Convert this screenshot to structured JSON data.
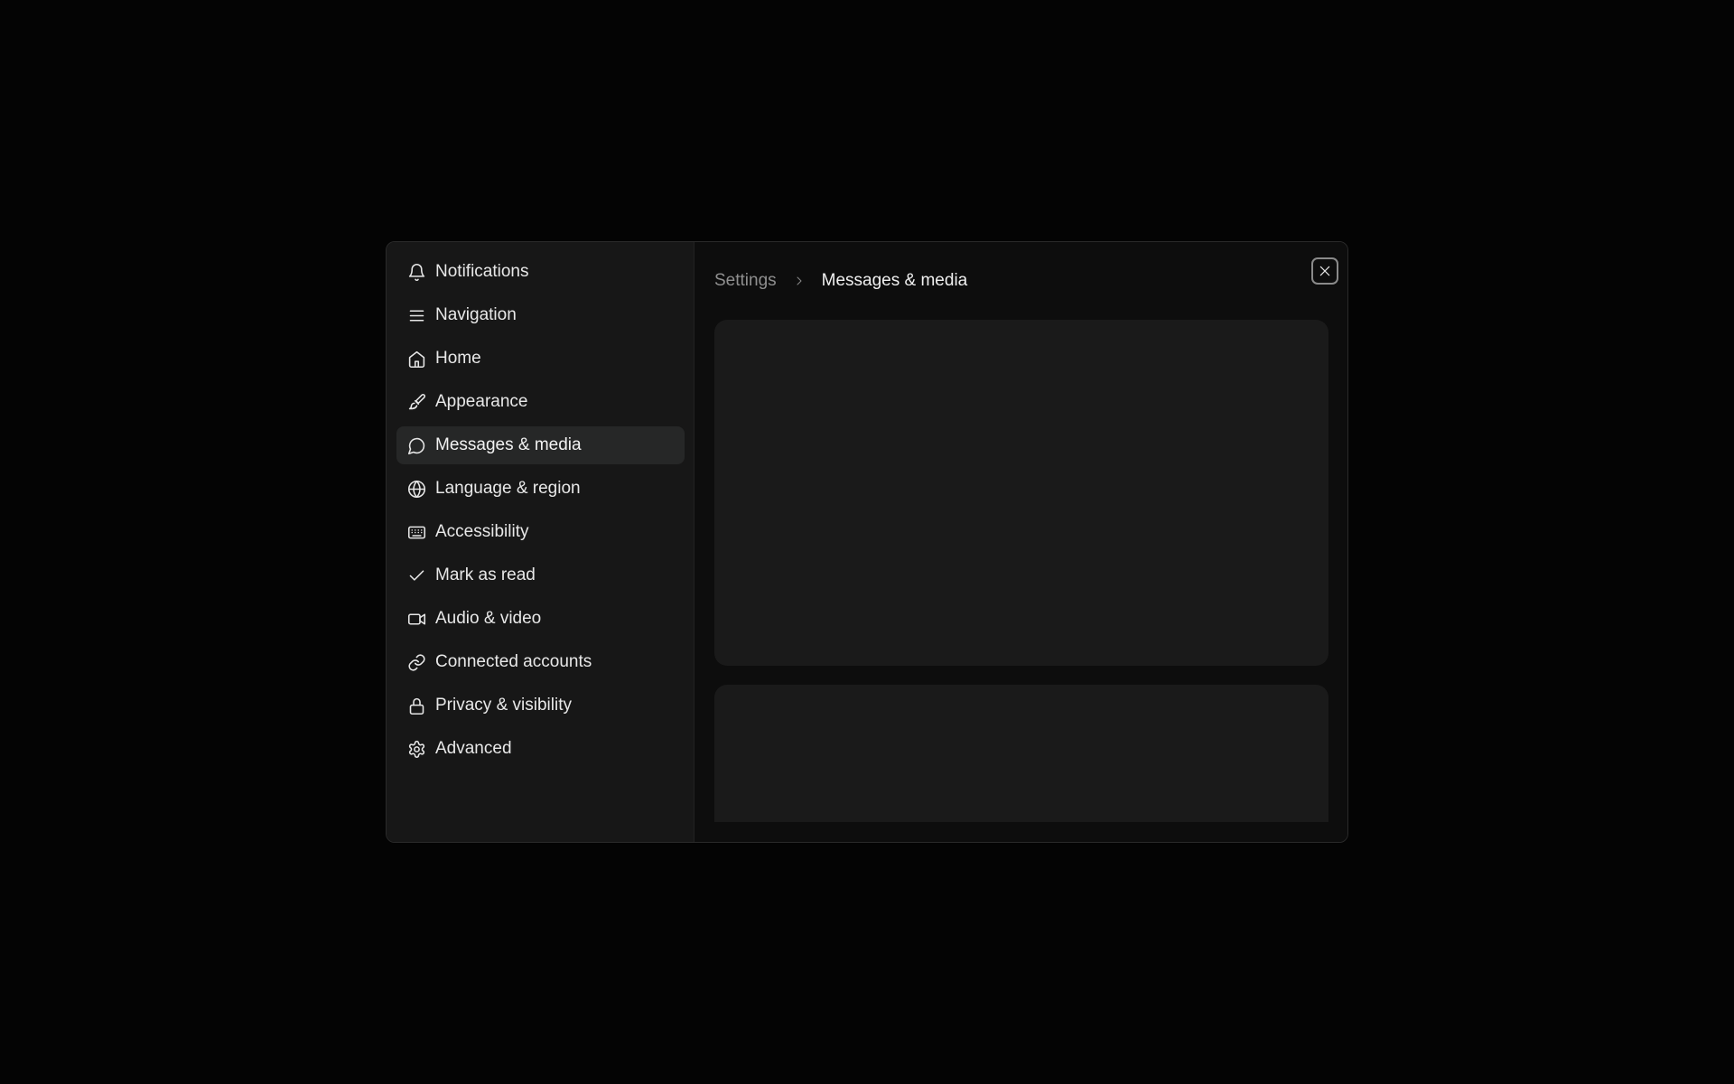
{
  "sidebar": {
    "items": [
      {
        "label": "Notifications",
        "icon": "bell-icon",
        "active": false
      },
      {
        "label": "Navigation",
        "icon": "menu-icon",
        "active": false
      },
      {
        "label": "Home",
        "icon": "home-icon",
        "active": false
      },
      {
        "label": "Appearance",
        "icon": "paintbrush-icon",
        "active": false
      },
      {
        "label": "Messages & media",
        "icon": "message-circle-icon",
        "active": true
      },
      {
        "label": "Language & region",
        "icon": "globe-icon",
        "active": false
      },
      {
        "label": "Accessibility",
        "icon": "keyboard-icon",
        "active": false
      },
      {
        "label": "Mark as read",
        "icon": "check-icon",
        "active": false
      },
      {
        "label": "Audio & video",
        "icon": "video-icon",
        "active": false
      },
      {
        "label": "Connected accounts",
        "icon": "link-icon",
        "active": false
      },
      {
        "label": "Privacy & visibility",
        "icon": "lock-icon",
        "active": false
      },
      {
        "label": "Advanced",
        "icon": "gear-icon",
        "active": false
      }
    ]
  },
  "breadcrumb": {
    "root": "Settings",
    "current": "Messages & media"
  },
  "colors": {
    "background": "#040404",
    "sidebar": "#171717",
    "active_item": "#262727",
    "card": "#1a1a1a"
  }
}
